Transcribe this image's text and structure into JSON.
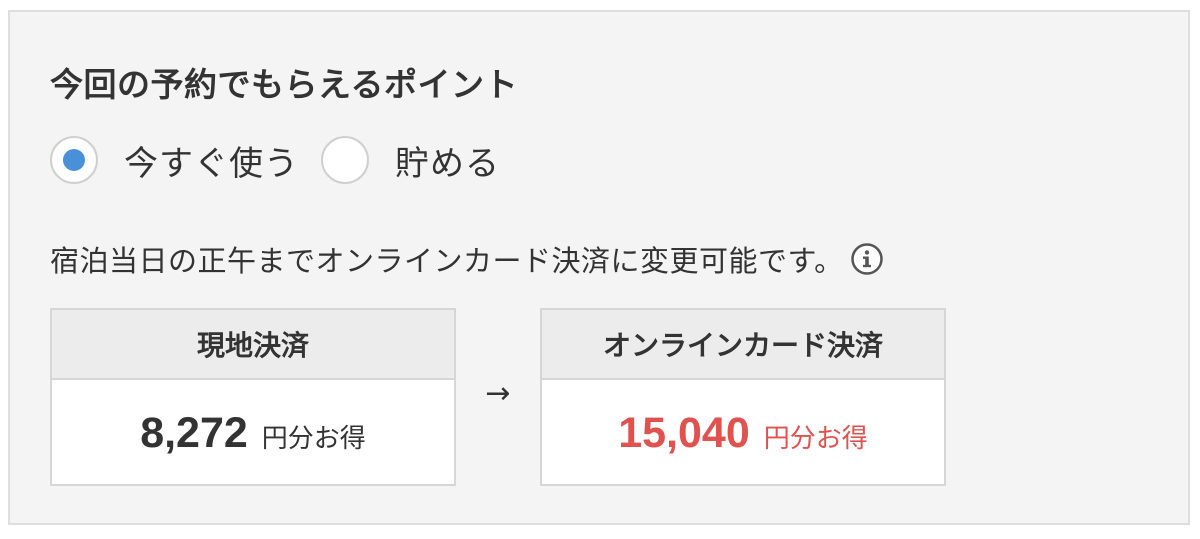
{
  "points_section": {
    "title": "今回の予約でもらえるポイント",
    "options": [
      {
        "label": "今すぐ使う",
        "selected": true
      },
      {
        "label": "貯める",
        "selected": false
      }
    ],
    "note": "宿泊当日の正午までオンラインカード決済に変更可能です。",
    "info_icon": "info-circle-icon",
    "comparison": {
      "arrow": "→",
      "onsite": {
        "header": "現地決済",
        "amount": "8,272",
        "unit": "円分お得"
      },
      "online": {
        "header": "オンラインカード決済",
        "amount": "15,040",
        "unit": "円分お得"
      }
    }
  },
  "colors": {
    "accent_blue": "#4a90d9",
    "highlight_red": "#e0524f",
    "panel_bg": "#f4f4f4",
    "text": "#333333"
  }
}
